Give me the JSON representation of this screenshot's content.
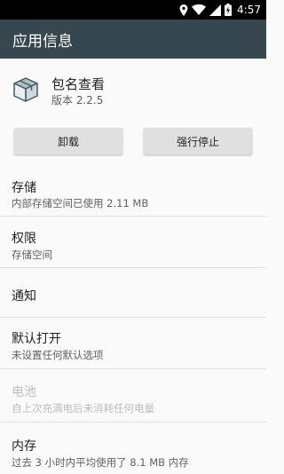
{
  "status_bar": {
    "time": "4:57"
  },
  "app_bar": {
    "title": "应用信息"
  },
  "app": {
    "name": "包名查看",
    "version": "版本 2.2.5",
    "icon": "package-box-icon"
  },
  "buttons": {
    "uninstall": "卸载",
    "force_stop": "强行停止"
  },
  "sections": [
    {
      "title": "存储",
      "subtitle": "内部存储空间已使用 2.11 MB",
      "enabled": true
    },
    {
      "title": "权限",
      "subtitle": "存储空间",
      "enabled": true
    },
    {
      "title": "通知",
      "subtitle": "",
      "enabled": true
    },
    {
      "title": "默认打开",
      "subtitle": "未设置任何默认选项",
      "enabled": true
    },
    {
      "title": "电池",
      "subtitle": "自上次充满电后未消耗任何电量",
      "enabled": false
    },
    {
      "title": "内存",
      "subtitle": "过去 3 小时内平均使用了 8.1 MB 内存",
      "enabled": true
    }
  ],
  "colors": {
    "app_bar": "#37474f",
    "status_bar": "#000000",
    "button": "#e0e0e0",
    "background": "#fafafa"
  }
}
